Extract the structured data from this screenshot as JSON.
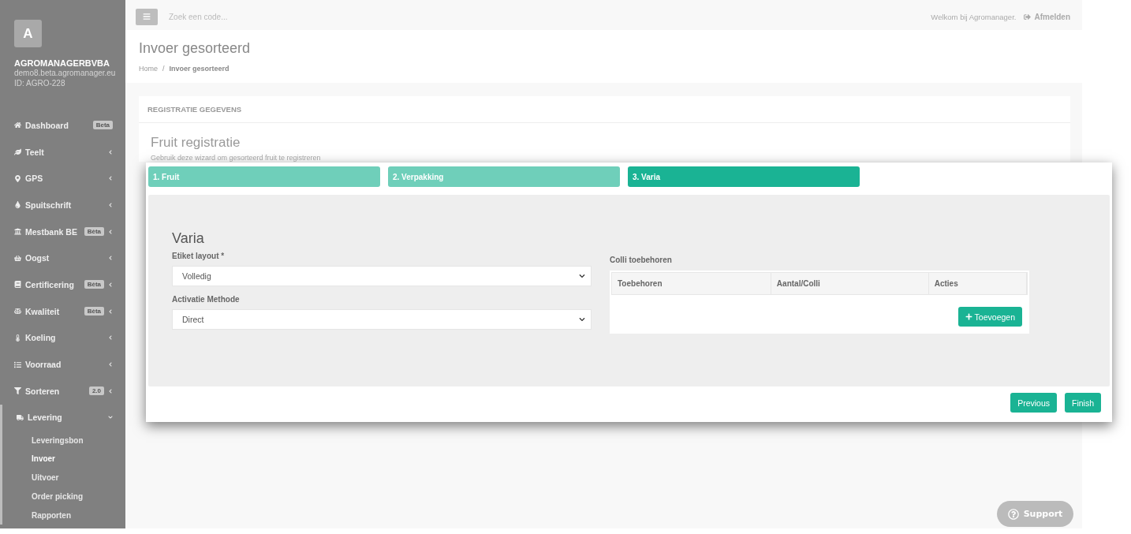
{
  "sidebar": {
    "avatar": "A",
    "company": "AGROMANAGERBVBA",
    "domain": "demo8.beta.agromanager.eu",
    "account_id": "ID: AGRO-228",
    "items": [
      {
        "label": "Dashboard",
        "badge": "Beta"
      },
      {
        "label": "Teelt",
        "expanded": false
      },
      {
        "label": "GPS",
        "expanded": false
      },
      {
        "label": "Spuitschrift",
        "expanded": false
      },
      {
        "label": "Mestbank BE",
        "badge": "Bèta",
        "expanded": false
      },
      {
        "label": "Oogst",
        "expanded": false
      },
      {
        "label": "Certificering",
        "badge": "Bèta",
        "expanded": false
      },
      {
        "label": "Kwaliteit",
        "badge": "Bèta",
        "expanded": false
      },
      {
        "label": "Koeling",
        "expanded": false
      },
      {
        "label": "Voorraad",
        "expanded": false
      },
      {
        "label": "Sorteren",
        "badge": "2.0",
        "expanded": false
      },
      {
        "label": "Levering",
        "expanded": true,
        "children": [
          {
            "label": "Leveringsbon",
            "selected": false
          },
          {
            "label": "Invoer",
            "selected": true
          },
          {
            "label": "Uitvoer",
            "selected": false
          },
          {
            "label": "Order picking",
            "selected": false
          },
          {
            "label": "Rapporten",
            "selected": false
          }
        ]
      }
    ]
  },
  "topbar": {
    "search_placeholder": "Zoek een code...",
    "welcome": "Welkom bij Agromanager.",
    "logout": "Afmelden"
  },
  "page": {
    "title": "Invoer gesorteerd",
    "breadcrumb": [
      "Home",
      "Invoer gesorteerd"
    ],
    "breadcrumb_separator": "/"
  },
  "card": {
    "header": "REGISTRATIE GEGEVENS",
    "title": "Fruit registratie",
    "subtitle": "Gebruik deze wizard om gesorteerd fruit te registreren"
  },
  "wizard": {
    "steps": [
      {
        "label": "1. Fruit",
        "selected": false
      },
      {
        "label": "2. Verpakking",
        "selected": false
      },
      {
        "label": "3. Varia",
        "selected": true
      }
    ],
    "section_title": "Varia",
    "fields": [
      {
        "label": "Etiket layout *",
        "value": "Volledig"
      },
      {
        "label": "Activatie Methode",
        "value": "Direct"
      }
    ],
    "colli": {
      "label": "Colli toebehoren",
      "columns": [
        "Toebehoren",
        "Aantal/Colli",
        "Acties"
      ],
      "add_button": "Toevoegen"
    },
    "buttons": [
      "Previous",
      "Finish"
    ]
  },
  "support": "Support"
}
